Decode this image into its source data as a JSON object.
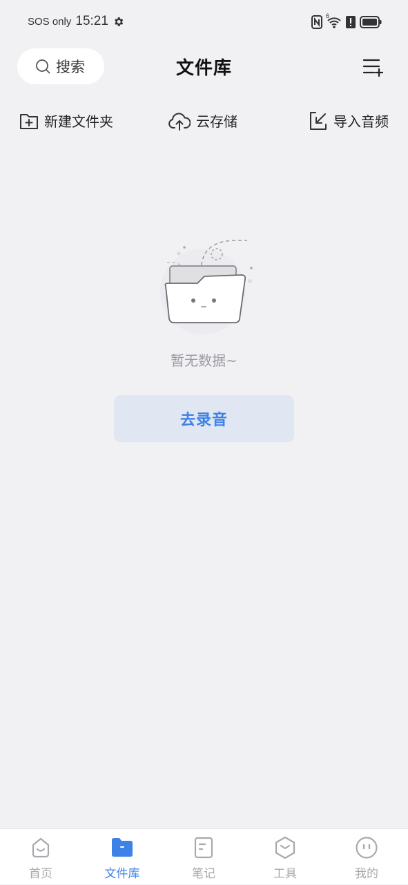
{
  "status_bar": {
    "carrier": "SOS only",
    "time": "15:21",
    "network_superscript": "6"
  },
  "header": {
    "search_label": "搜索",
    "title": "文件库"
  },
  "actions": [
    {
      "label": "新建文件夹",
      "icon": "folder-plus-icon"
    },
    {
      "label": "云存储",
      "icon": "cloud-upload-icon"
    },
    {
      "label": "导入音频",
      "icon": "import-icon"
    }
  ],
  "empty_state": {
    "message": "暂无数据~",
    "button_label": "去录音"
  },
  "bottom_nav": {
    "active_index": 1,
    "active_color": "#3d82e6",
    "inactive_color": "#a8a8ae",
    "items": [
      {
        "label": "首页",
        "icon": "home-icon"
      },
      {
        "label": "文件库",
        "icon": "folder-icon"
      },
      {
        "label": "笔记",
        "icon": "note-icon"
      },
      {
        "label": "工具",
        "icon": "tools-icon"
      },
      {
        "label": "我的",
        "icon": "profile-icon"
      }
    ]
  }
}
